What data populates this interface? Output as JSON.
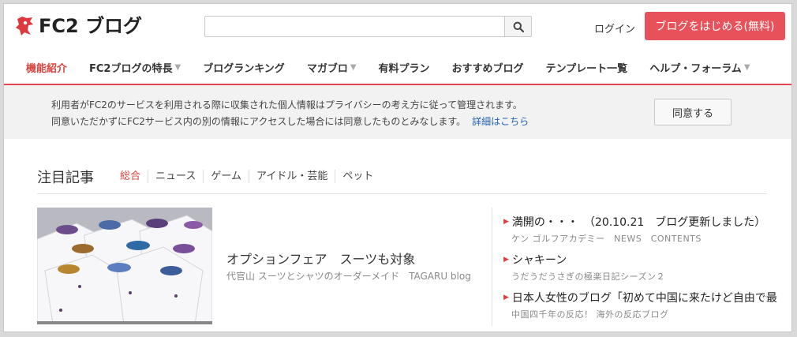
{
  "header": {
    "logo_text": "FC2 ブログ",
    "search_placeholder": "",
    "login_label": "ログイン",
    "start_button_label": "ブログをはじめる(無料)",
    "brand_color": "#e8515a"
  },
  "nav": {
    "items": [
      {
        "label": "機能紹介",
        "caret": false
      },
      {
        "label": "FC2ブログの特長",
        "caret": true
      },
      {
        "label": "ブログランキング",
        "caret": false
      },
      {
        "label": "マガブロ",
        "caret": true
      },
      {
        "label": "有料プラン",
        "caret": false
      },
      {
        "label": "おすすめブログ",
        "caret": false
      },
      {
        "label": "テンプレート一覧",
        "caret": false
      },
      {
        "label": "ヘルプ・フォーラム",
        "caret": true
      }
    ]
  },
  "notice": {
    "line1": "利用者がFC2のサービスを利用される際に収集された個人情報はプライバシーの考え方に従って管理されます。",
    "line2": "同意いただかずにFC2サービス内の別の情報にアクセスした場合には同意したものとみなします。",
    "link_label": "詳細はこちら",
    "agree_label": "同意する"
  },
  "featured": {
    "heading": "注目記事",
    "tabs": [
      "総合",
      "ニュース",
      "ゲーム",
      "アイドル・芸能",
      "ペット"
    ],
    "main": {
      "title": "オプションフェア　スーツも対象",
      "subtitle": "代官山 スーツとシャツのオーダーメイド　TAGARU blog"
    },
    "side": [
      {
        "title": "満開の・・・　（20.10.21　ブログ更新しました）",
        "sub": "ケン ゴルフアカデミー　NEWS　CONTENTS"
      },
      {
        "title": "シャキーン",
        "sub": "うだうだうさぎの極楽日記シーズン２"
      },
      {
        "title": "日本人女性のブログ「初めて中国に来たけど自由で最",
        "sub": "中国四千年の反応！ 海外の反応ブログ"
      }
    ]
  }
}
